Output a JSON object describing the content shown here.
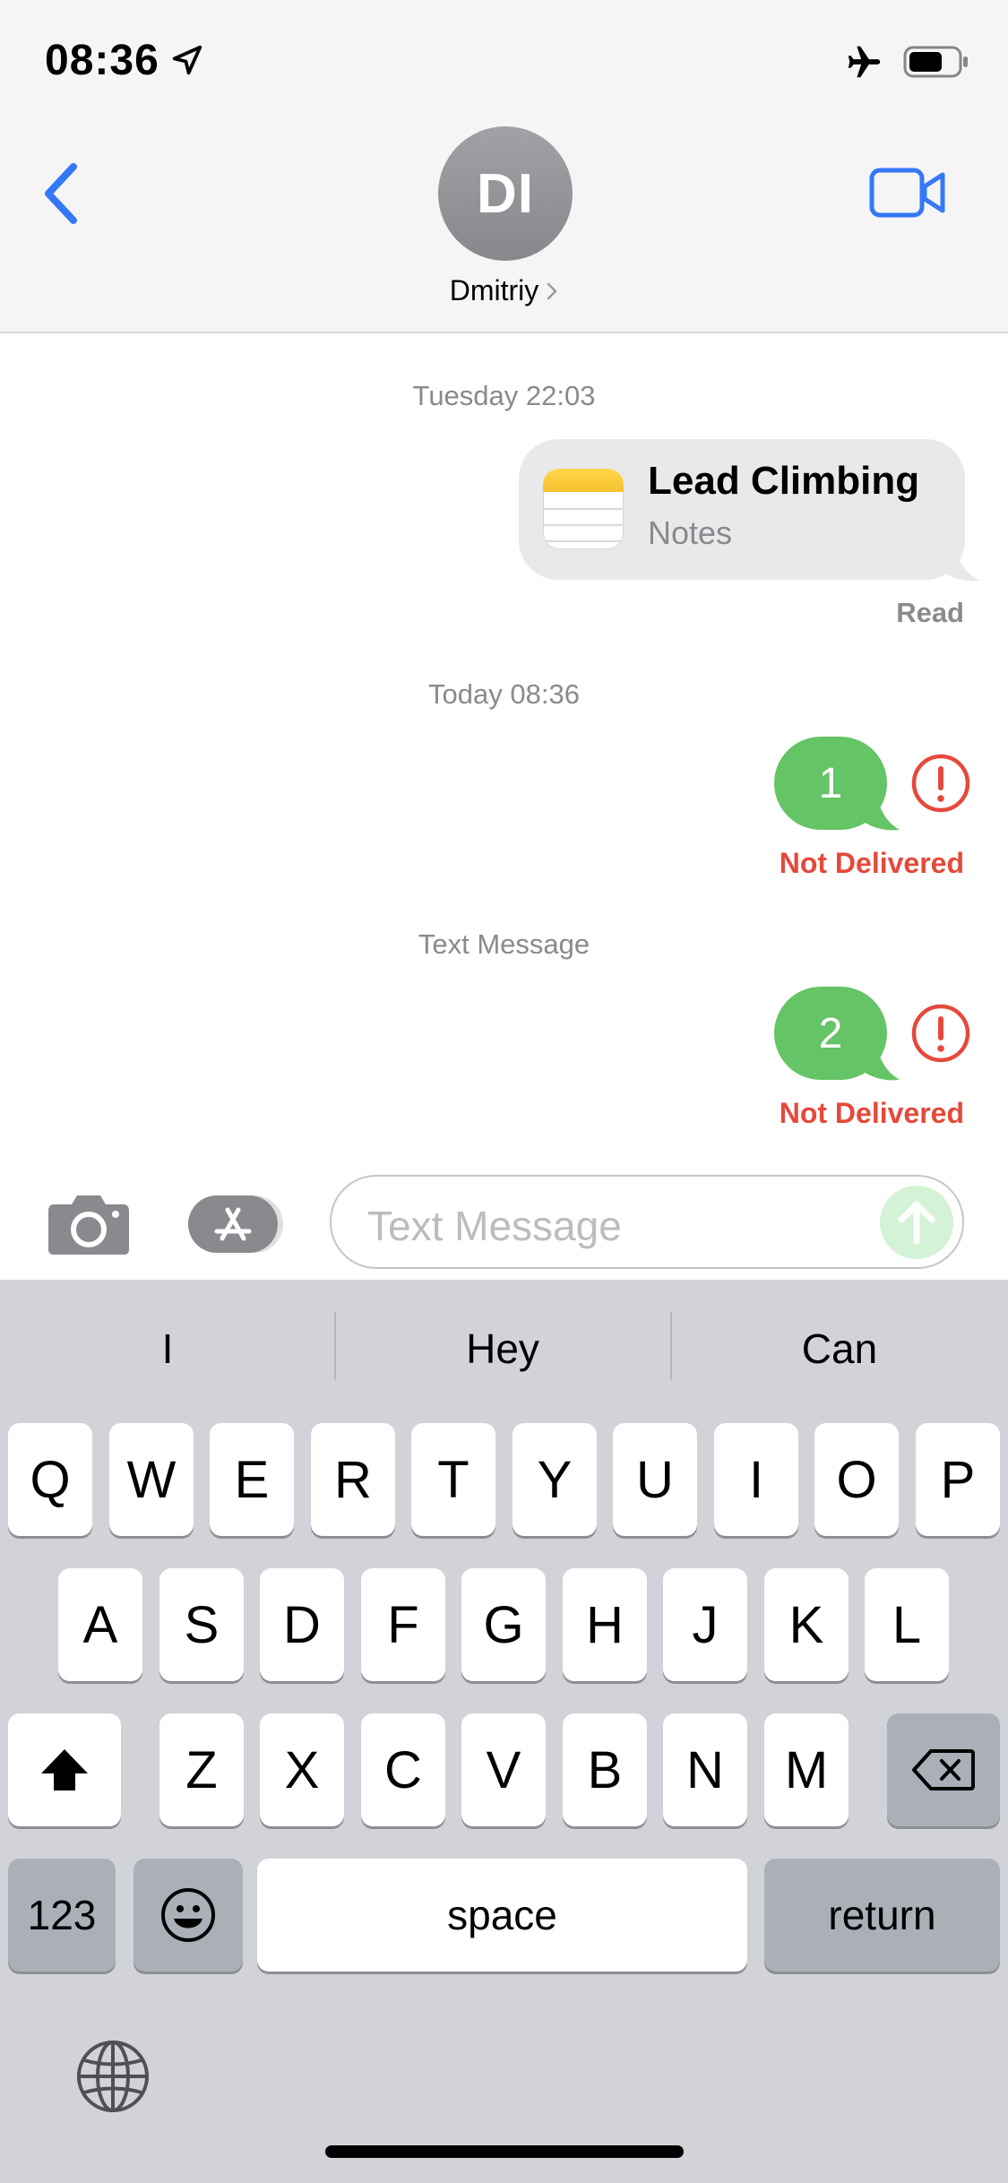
{
  "status_bar": {
    "time": "08:36"
  },
  "header": {
    "avatar_initials": "DI",
    "contact_name": "Dmitriy"
  },
  "conversation": {
    "timestamp_1": "Tuesday 22:03",
    "note_card": {
      "title": "Lead Climbing",
      "subtitle": "Notes",
      "receipt": "Read"
    },
    "timestamp_2": "Today 08:36",
    "message_1": {
      "text": "1",
      "status": "Not Delivered"
    },
    "service_label": "Text Message",
    "message_2": {
      "text": "2",
      "status": "Not Delivered"
    }
  },
  "input_bar": {
    "placeholder": "Text Message"
  },
  "keyboard": {
    "suggestions": [
      "I",
      "Hey",
      "Can"
    ],
    "row1": [
      "Q",
      "W",
      "E",
      "R",
      "T",
      "Y",
      "U",
      "I",
      "O",
      "P"
    ],
    "row2": [
      "A",
      "S",
      "D",
      "F",
      "G",
      "H",
      "J",
      "K",
      "L"
    ],
    "row3": [
      "Z",
      "X",
      "C",
      "V",
      "B",
      "N",
      "M"
    ],
    "numbers_key": "123",
    "space_key": "space",
    "return_key": "return"
  },
  "colors": {
    "accent_blue": "#3478f6",
    "sms_green": "#65c466",
    "error_red": "#e5493b",
    "gray_text": "#8a8a8e"
  }
}
